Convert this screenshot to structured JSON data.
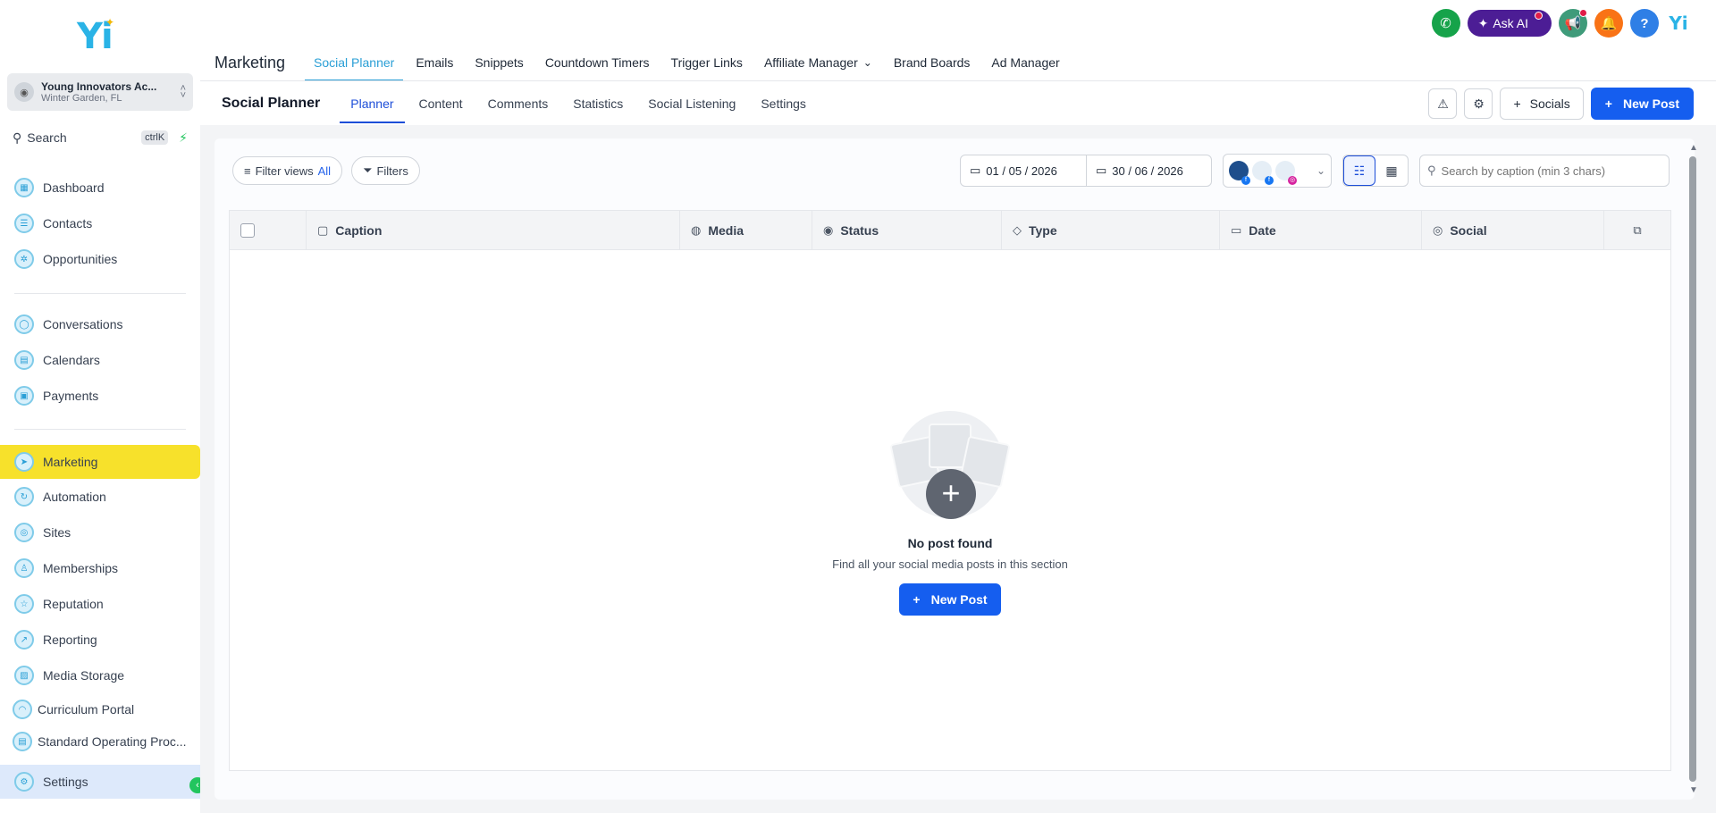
{
  "brand": {
    "logo_text": "Yi"
  },
  "account": {
    "name": "Young Innovators Ac...",
    "location": "Winter Garden, FL"
  },
  "search": {
    "label": "Search",
    "shortcut": "ctrlK"
  },
  "sidebar": {
    "items": [
      {
        "label": "Dashboard"
      },
      {
        "label": "Contacts"
      },
      {
        "label": "Opportunities"
      },
      {
        "label": "Conversations"
      },
      {
        "label": "Calendars"
      },
      {
        "label": "Payments"
      },
      {
        "label": "Marketing"
      },
      {
        "label": "Automation"
      },
      {
        "label": "Sites"
      },
      {
        "label": "Memberships"
      },
      {
        "label": "Reputation"
      },
      {
        "label": "Reporting"
      },
      {
        "label": "Media Storage"
      },
      {
        "label": "Curriculum Portal"
      },
      {
        "label": "Standard Operating Proc..."
      },
      {
        "label": "Settings"
      }
    ]
  },
  "topbar": {
    "ask_ai": "Ask AI",
    "help": "?"
  },
  "main_nav": {
    "section": "Marketing",
    "tabs": [
      {
        "label": "Social Planner"
      },
      {
        "label": "Emails"
      },
      {
        "label": "Snippets"
      },
      {
        "label": "Countdown Timers"
      },
      {
        "label": "Trigger Links"
      },
      {
        "label": "Affiliate Manager"
      },
      {
        "label": "Brand Boards"
      },
      {
        "label": "Ad Manager"
      }
    ]
  },
  "sub_nav": {
    "title": "Social Planner",
    "tabs": [
      {
        "label": "Planner"
      },
      {
        "label": "Content"
      },
      {
        "label": "Comments"
      },
      {
        "label": "Statistics"
      },
      {
        "label": "Social Listening"
      },
      {
        "label": "Settings"
      }
    ],
    "socials_label": "Socials",
    "new_post_label": "New Post"
  },
  "toolbar": {
    "filter_views": "Filter views",
    "filter_views_value": "All",
    "filters": "Filters",
    "date_from": "01 / 05 / 2026",
    "date_to": "30 / 06 / 2026",
    "caption_placeholder": "Search by caption (min 3 chars)"
  },
  "table": {
    "columns": [
      {
        "label": "Caption",
        "icon": "text-icon"
      },
      {
        "label": "Media",
        "icon": "image-icon"
      },
      {
        "label": "Status",
        "icon": "check-circle-icon"
      },
      {
        "label": "Type",
        "icon": "tag-icon"
      },
      {
        "label": "Date",
        "icon": "calendar-icon"
      },
      {
        "label": "Social",
        "icon": "user-circle-icon"
      }
    ]
  },
  "empty_state": {
    "title": "No post found",
    "subtitle": "Find all your social media posts in this section",
    "button_label": "New Post"
  },
  "colors": {
    "accent": "#155eef",
    "active_nav": "#f7e12b",
    "brand": "#2ab3e6"
  }
}
